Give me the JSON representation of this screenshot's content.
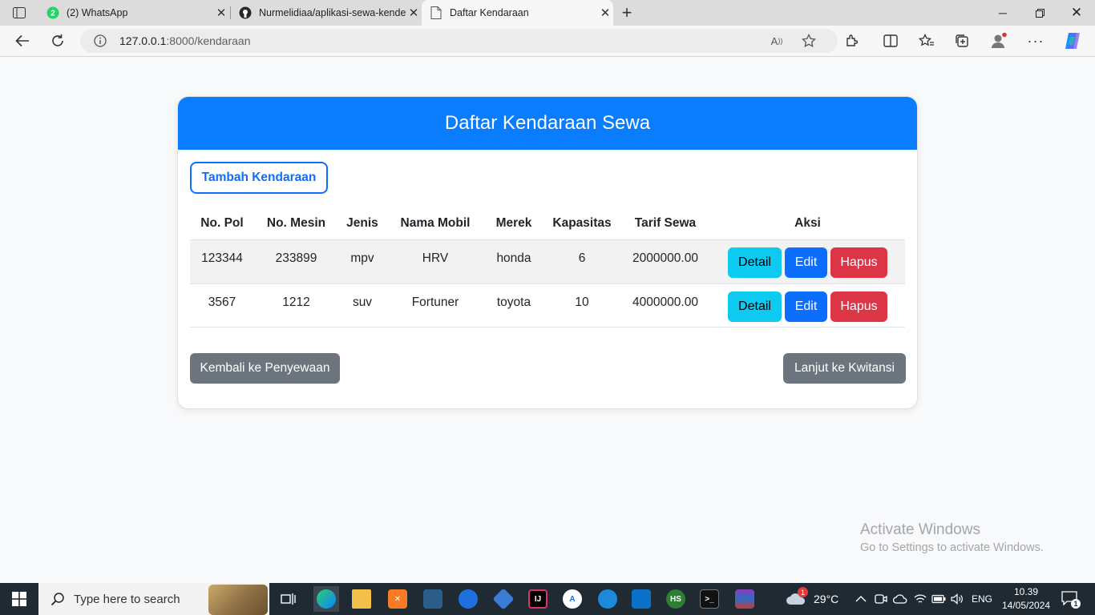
{
  "browser": {
    "tabs": [
      {
        "title": "(2) WhatsApp",
        "badge": "2",
        "icon": "whatsapp-icon"
      },
      {
        "title": "Nurmelidiaa/aplikasi-sewa-kende",
        "icon": "github-icon"
      },
      {
        "title": "Daftar Kendaraan",
        "icon": "page-icon",
        "active": true
      }
    ],
    "url_host": "127.0.0.1",
    "url_path": ":8000/kendaraan"
  },
  "page": {
    "header_title": "Daftar Kendaraan Sewa",
    "add_button": "Tambah Kendaraan",
    "columns": [
      "No. Pol",
      "No. Mesin",
      "Jenis",
      "Nama Mobil",
      "Merek",
      "Kapasitas",
      "Tarif Sewa",
      "Aksi"
    ],
    "rows": [
      {
        "no_pol": "123344",
        "no_mesin": "233899",
        "jenis": "mpv",
        "nama_mobil": "HRV",
        "merek": "honda",
        "kapasitas": "6",
        "tarif_sewa": "2000000.00"
      },
      {
        "no_pol": "3567",
        "no_mesin": "1212",
        "jenis": "suv",
        "nama_mobil": "Fortuner",
        "merek": "toyota",
        "kapasitas": "10",
        "tarif_sewa": "4000000.00"
      }
    ],
    "actions": {
      "detail": "Detail",
      "edit": "Edit",
      "delete": "Hapus"
    },
    "back_button": "Kembali ke Penyewaan",
    "next_button": "Lanjut ke Kwitansi"
  },
  "watermark": {
    "line1": "Activate Windows",
    "line2": "Go to Settings to activate Windows."
  },
  "taskbar": {
    "search_placeholder": "Type here to search",
    "weather_temp": "29°C",
    "weather_badge": "1",
    "language": "ENG",
    "time": "10.39",
    "date": "14/05/2024",
    "notifications": "1"
  },
  "colors": {
    "header_blue": "#0a7cfe",
    "primary": "#0d6efd",
    "info": "#0dcaf0",
    "danger": "#dc3545",
    "secondary": "#6c757d"
  }
}
